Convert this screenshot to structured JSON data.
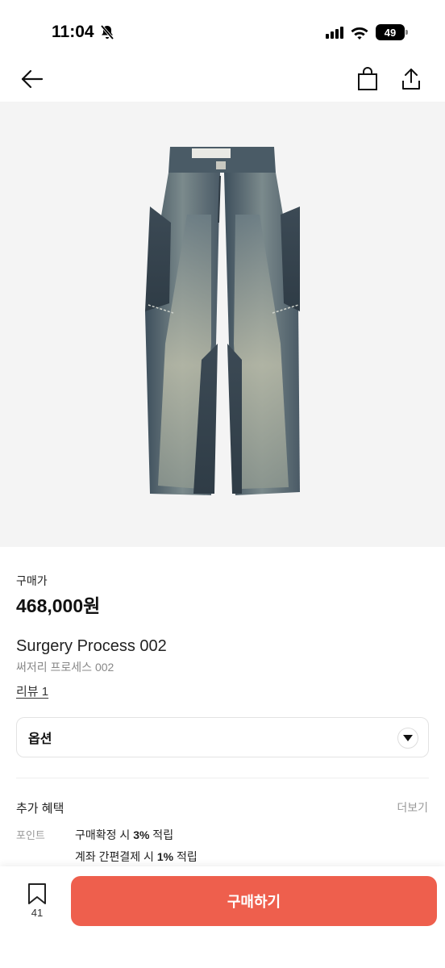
{
  "status_bar": {
    "time": "11:04",
    "battery": "49"
  },
  "product": {
    "price_label": "구매가",
    "price": "468,000원",
    "title_en": "Surgery Process 002",
    "title_ko": "써저리 프로세스 002",
    "review_link": "리뷰 1"
  },
  "option": {
    "label": "옵션"
  },
  "benefits": {
    "title": "추가 혜택",
    "more": "더보기",
    "point_label": "포인트",
    "line1_prefix": "구매확정 시 ",
    "line1_bold": "3%",
    "line1_suffix": " 적립",
    "line2_prefix": "계좌 간편결제 시 ",
    "line2_bold": "1%",
    "line2_suffix": " 적립"
  },
  "bottom_bar": {
    "bookmark_count": "41",
    "buy_label": "구매하기"
  },
  "colors": {
    "accent": "#ee5f4d",
    "image_bg": "#f4f4f4"
  },
  "icons": [
    "bell-off-icon",
    "signal-icon",
    "wifi-icon",
    "battery-icon",
    "back-arrow-icon",
    "shopping-bag-icon",
    "share-icon",
    "chevron-down-icon",
    "bookmark-icon"
  ]
}
